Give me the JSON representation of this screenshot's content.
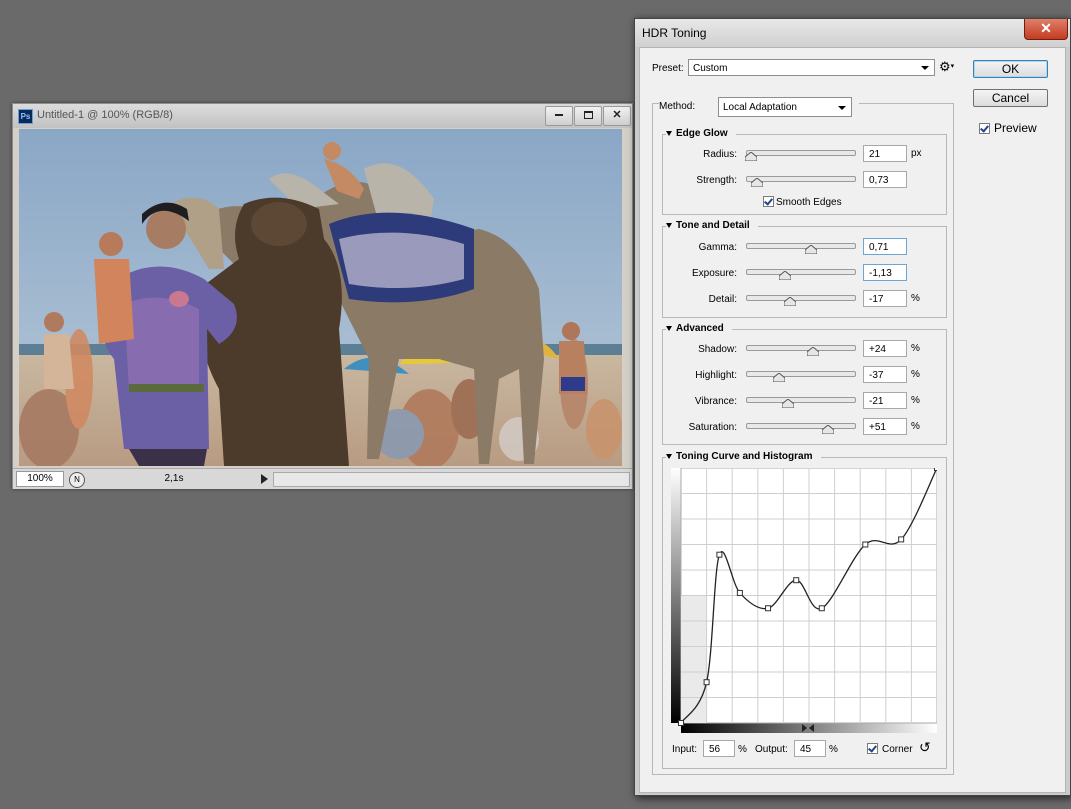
{
  "document": {
    "title": "Untitled-1 @ 100% (RGB/8)",
    "app_icon": "Ps",
    "zoom": "100%",
    "status_value": "2,1s",
    "controls": {
      "minimize": "minimize-icon",
      "restore": "restore-icon",
      "close": "close-icon"
    }
  },
  "dialog": {
    "title": "HDR Toning",
    "close_glyph": "✕",
    "preset_label": "Preset:",
    "preset_value": "Custom",
    "ok_label": "OK",
    "cancel_label": "Cancel",
    "preview_label": "Preview",
    "preview_checked": true,
    "method_label": "Method:",
    "method_value": "Local Adaptation",
    "edge_glow": {
      "title": "Edge Glow",
      "radius": {
        "label": "Radius:",
        "value": "21",
        "unit": "px",
        "position": 0.05
      },
      "strength": {
        "label": "Strength:",
        "value": "0,73",
        "position": 0.1
      },
      "smooth_edges": {
        "label": "Smooth Edges",
        "checked": true
      }
    },
    "tone_detail": {
      "title": "Tone and Detail",
      "gamma": {
        "label": "Gamma:",
        "value": "0,71",
        "position": 0.6
      },
      "exposure": {
        "label": "Exposure:",
        "value": "-1,13",
        "position": 0.36
      },
      "detail": {
        "label": "Detail:",
        "value": "-17",
        "unit": "%",
        "position": 0.41
      }
    },
    "advanced": {
      "title": "Advanced",
      "shadow": {
        "label": "Shadow:",
        "value": "+24",
        "unit": "%",
        "position": 0.62
      },
      "highlight": {
        "label": "Highlight:",
        "value": "-37",
        "unit": "%",
        "position": 0.31
      },
      "vibrance": {
        "label": "Vibrance:",
        "value": "-21",
        "unit": "%",
        "position": 0.39
      },
      "saturation": {
        "label": "Saturation:",
        "value": "+51",
        "unit": "%",
        "position": 0.76
      }
    },
    "curve": {
      "title": "Toning Curve and Histogram",
      "input_label": "Input:",
      "input_value": "56",
      "input_unit": "%",
      "output_label": "Output:",
      "output_value": "45",
      "output_unit": "%",
      "corner_label": "Corner",
      "corner_checked": true,
      "points": [
        [
          0,
          0
        ],
        [
          0.1,
          0.16
        ],
        [
          0.15,
          0.66
        ],
        [
          0.23,
          0.51
        ],
        [
          0.34,
          0.45
        ],
        [
          0.45,
          0.56
        ],
        [
          0.55,
          0.45
        ],
        [
          0.72,
          0.7
        ],
        [
          0.86,
          0.72
        ],
        [
          1,
          1
        ]
      ]
    },
    "colors": {
      "accent": "#3c7fb1",
      "titlebar": "#d8d8d8",
      "close": "#c43b21"
    }
  }
}
